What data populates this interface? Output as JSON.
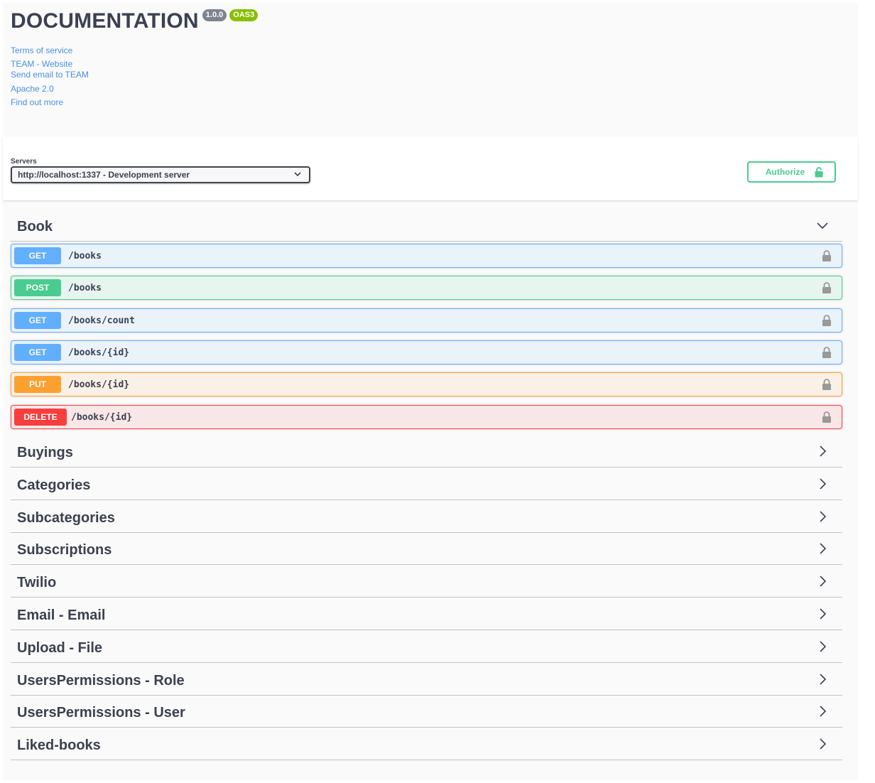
{
  "info": {
    "title": "DOCUMENTATION",
    "version": "1.0.0",
    "oas": "OAS3",
    "links": {
      "terms": "Terms of service",
      "website": "TEAM - Website",
      "email": "Send email to TEAM",
      "license": "Apache 2.0",
      "more": "Find out more"
    }
  },
  "servers": {
    "label": "Servers",
    "selected": "http://localhost:1337 - Development server"
  },
  "authorize": {
    "label": "Authorize",
    "icon": "unlock-icon"
  },
  "book": {
    "title": "Book",
    "operations": [
      {
        "method": "GET",
        "path": "/books"
      },
      {
        "method": "POST",
        "path": "/books"
      },
      {
        "method": "GET",
        "path": "/books/count"
      },
      {
        "method": "GET",
        "path": "/books/{id}"
      },
      {
        "method": "PUT",
        "path": "/books/{id}"
      },
      {
        "method": "DELETE",
        "path": "/books/{id}"
      }
    ]
  },
  "tags": [
    "Buyings",
    "Categories",
    "Subcategories",
    "Subscriptions",
    "Twilio",
    "Email - Email",
    "Upload - File",
    "UsersPermissions - Role",
    "UsersPermissions - User",
    "Liked-books"
  ],
  "colors": {
    "get": "#61affe",
    "post": "#49cc90",
    "put": "#fca130",
    "delete": "#f93e3e",
    "link": "#4990e2"
  }
}
